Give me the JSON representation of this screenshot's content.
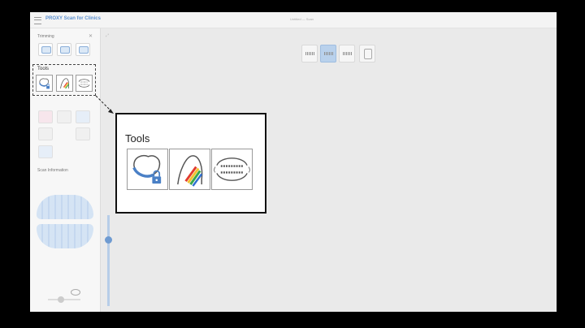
{
  "app": {
    "title": "PROXY Scan for Clinics",
    "file_name": "Untitled — Scan"
  },
  "sidebar": {
    "trimming_label": "Trimming",
    "tools_label": "Tools",
    "scan_info_label": "Scan Information",
    "tools": [
      {
        "name": "lock-region-tool",
        "icon": "tooth-lock-icon"
      },
      {
        "name": "color-texture-tool",
        "icon": "tooth-rainbow-icon"
      },
      {
        "name": "bite-alignment-tool",
        "icon": "bite-arch-icon"
      }
    ]
  },
  "callout": {
    "title": "Tools"
  },
  "colors": {
    "accent": "#5b8fcf",
    "lock": "#4a80c6"
  }
}
